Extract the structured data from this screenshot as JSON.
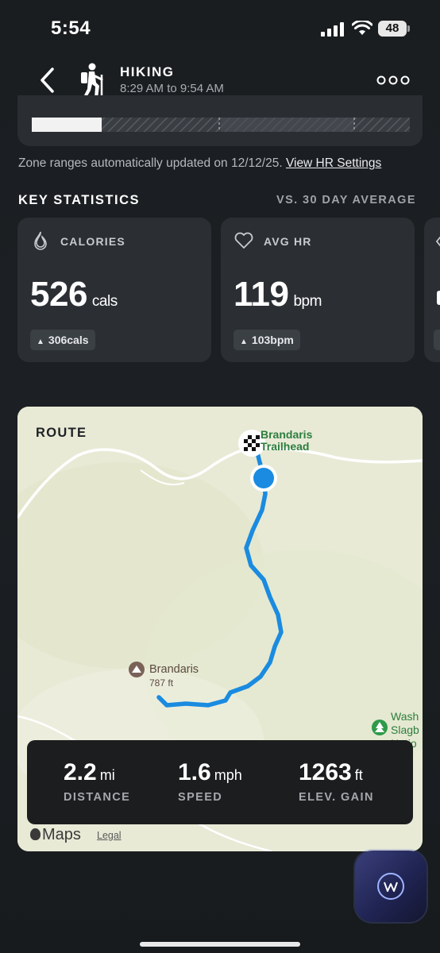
{
  "status_bar": {
    "time": "5:54",
    "battery": "48"
  },
  "header": {
    "title": "HIKING",
    "subtitle": "8:29 AM to 9:54 AM",
    "icon": "hiker-icon"
  },
  "zones": {
    "note": "Zone ranges automatically updated on 12/12/25.",
    "link": "View HR Settings"
  },
  "key_stats": {
    "title": "KEY STATISTICS",
    "compare": "VS. 30 DAY AVERAGE",
    "cards": [
      {
        "label": "CALORIES",
        "value": "526",
        "unit": "cals",
        "delta": "306cals",
        "icon": "flame-icon"
      },
      {
        "label": "AVG HR",
        "value": "119",
        "unit": "bpm",
        "delta": "103bpm",
        "icon": "heart-icon"
      }
    ]
  },
  "route": {
    "title": "ROUTE",
    "trailhead_label": "Brandaris Trailhead",
    "peak_name": "Brandaris",
    "peak_elev": "787 ft",
    "park_label": "Wash Slagb Natio",
    "stats": [
      {
        "value": "2.2",
        "unit": "mi",
        "label": "DISTANCE"
      },
      {
        "value": "1.6",
        "unit": "mph",
        "label": "SPEED"
      },
      {
        "value": "1263",
        "unit": "ft",
        "label": "ELEV. GAIN"
      }
    ],
    "maps_brand": "Maps",
    "legal": "Legal"
  },
  "colors": {
    "route": "#1a8be0",
    "card": "#2b2f34",
    "map_bg": "#e8ead6"
  }
}
